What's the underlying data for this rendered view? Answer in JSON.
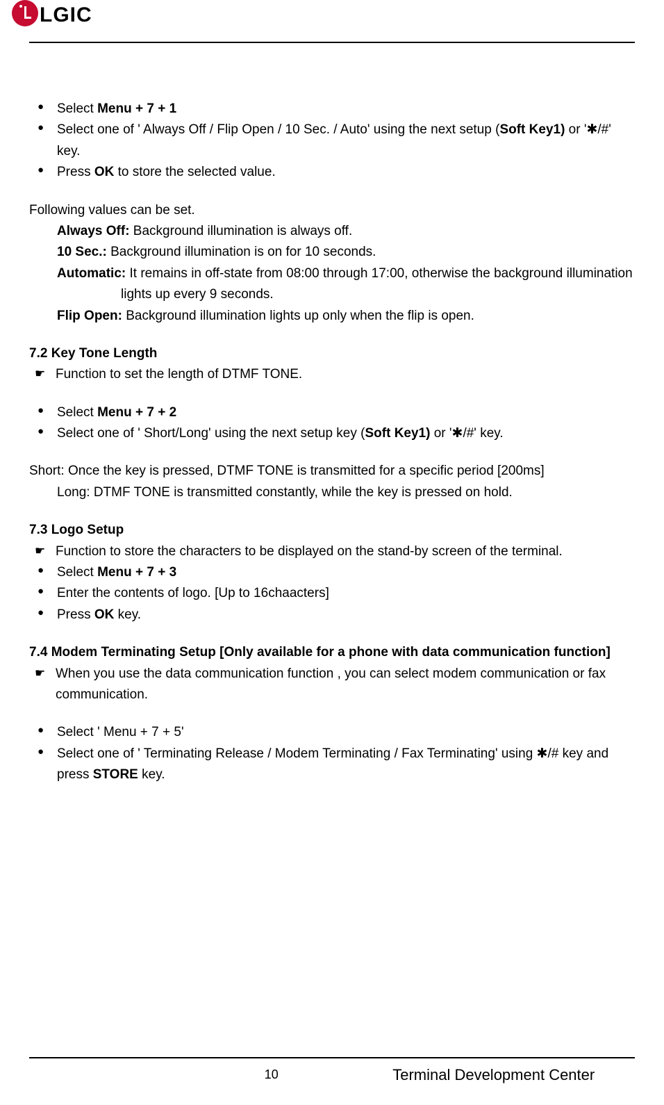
{
  "brand": "LGIC",
  "footer": {
    "page_num": "10",
    "right": "Terminal Development Center"
  },
  "s71": {
    "b1_pre": "Select ",
    "b1_bold": "Menu + 7 + 1",
    "b2_a": "Select one of ' Always Off / Flip Open / 10 Sec. / Auto'  using the next setup (",
    "b2_bold": "Soft Key1)",
    "b2_b": " or '✱/#' key.",
    "b3_a": "Press ",
    "b3_bold": "OK",
    "b3_b": " to store the selected value."
  },
  "following": {
    "intro": "Following values can be set.",
    "ao_label": "Always Off:",
    "ao_text": " Background illumination is always off.",
    "ts_label": "10 Sec.:",
    "ts_text": " Background illumination is on for 10 seconds.",
    "auto_label": "Automatic:",
    "auto_text1": " It remains in off-state from 08:00 through 17:00, otherwise the background illumination",
    "auto_text2": "lights up every 9 seconds.",
    "fo_label": "Flip Open:",
    "fo_text": " Background illumination lights up only when the flip is open."
  },
  "s72": {
    "heading": "7.2 Key Tone Length",
    "desc": "Function to set the length of DTMF TONE.",
    "b1_pre": "Select ",
    "b1_bold": "Menu + 7 + 2",
    "b2_a": "Select one of ' Short/Long'  using the next setup key (",
    "b2_bold": "Soft Key1)",
    "b2_b": " or '✱/#'  key.",
    "short": " Short: Once the key is pressed, DTMF TONE is transmitted for a specific period [200ms]",
    "long": "Long: DTMF TONE is transmitted constantly, while the key is pressed on hold."
  },
  "s73": {
    "heading": "7.3 Logo Setup",
    "desc": "Function to store the characters to be displayed on the stand-by screen of the terminal.",
    "b1_pre": "Select ",
    "b1_bold": "Menu + 7 + 3",
    "b2": "Enter the contents of logo. [Up to 16chaacters]",
    "b3_a": "Press ",
    "b3_bold": "OK",
    "b3_b": " key."
  },
  "s74": {
    "heading": "7.4 Modem Terminating Setup [Only available for a phone with data communication function]",
    "desc": "When you use the data communication function , you can select modem communication or fax communication.",
    "b1": "Select ' Menu + 7 + 5'",
    "b2_a": "Select one of ' Terminating Release / Modem Terminating / Fax Terminating'  using ✱/# key and press ",
    "b2_bold": "STORE",
    "b2_b": " key."
  }
}
